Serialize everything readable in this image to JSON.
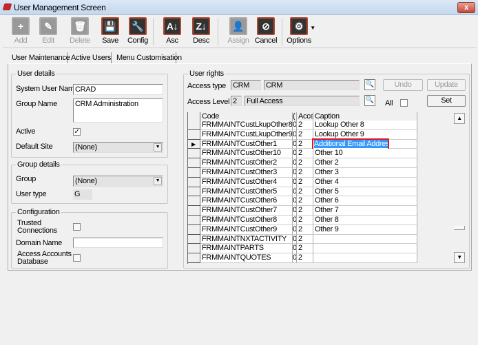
{
  "window": {
    "title": "User Management Screen",
    "close_label": "x"
  },
  "toolbar": [
    {
      "label": "Add",
      "icon": "plus-icon",
      "glyph": "+",
      "enabled": false
    },
    {
      "label": "Edit",
      "icon": "edit-icon",
      "glyph": "✎",
      "enabled": false
    },
    {
      "label": "Delete",
      "icon": "trash-icon",
      "glyph": "🗑",
      "enabled": false
    },
    {
      "label": "Save",
      "icon": "floppy-icon",
      "glyph": "💾",
      "enabled": true
    },
    {
      "label": "Config",
      "icon": "wrench-icon",
      "glyph": "🔧",
      "enabled": true
    },
    {
      "label": "Asc",
      "icon": "sort-asc-icon",
      "glyph": "A↓",
      "enabled": true
    },
    {
      "label": "Desc",
      "icon": "sort-desc-icon",
      "glyph": "Z↓",
      "enabled": true
    },
    {
      "label": "Assign",
      "icon": "user-icon",
      "glyph": "👤",
      "enabled": false
    },
    {
      "label": "Cancel",
      "icon": "cancel-icon",
      "glyph": "⊘",
      "enabled": true
    },
    {
      "label": "Options",
      "icon": "gear-icon",
      "glyph": "⚙",
      "enabled": true
    }
  ],
  "tabs": [
    "User Maintenance",
    "Active Users",
    "Menu Customisation"
  ],
  "user_details": {
    "legend": "User details",
    "system_user_name_label": "System User Name",
    "system_user_name": "CRAD",
    "group_name_label": "Group Name",
    "group_name": "CRM Administration",
    "active_label": "Active",
    "active_check": "✓",
    "default_site_label": "Default Site",
    "default_site": "(None)"
  },
  "group_details": {
    "legend": "Group details",
    "group_label": "Group",
    "group": "(None)",
    "user_type_label": "User type",
    "user_type": "G"
  },
  "configuration": {
    "legend": "Configuration",
    "trusted_label_1": "Trusted",
    "trusted_label_2": "Connections",
    "domain_label": "Domain Name",
    "domain": "",
    "access_label_1": "Access Accounts",
    "access_label_2": "Database"
  },
  "user_rights": {
    "legend": "User rights",
    "access_type_label": "Access type",
    "access_type_code": "CRM",
    "access_type_name": "CRM",
    "access_level_label": "Access Level",
    "access_level_code": "2",
    "access_level_name": "Full Access",
    "all_label": "All",
    "undo": "Undo",
    "update": "Update",
    "set": "Set"
  },
  "grid": {
    "headers": [
      "Code",
      "(",
      "Acce",
      "Caption"
    ],
    "rows": [
      [
        "FRMMAINTCustLkupOther8",
        "0",
        "2",
        "Lookup Other 8"
      ],
      [
        "FRMMAINTCustLkupOther9",
        "0",
        "2",
        "Lookup Other 9"
      ],
      [
        "FRMMAINTCustOther1",
        "0",
        "2",
        "Additional Email Address"
      ],
      [
        "FRMMAINTCustOther10",
        "0",
        "2",
        "Other 10"
      ],
      [
        "FRMMAINTCustOther2",
        "0",
        "2",
        "Other 2"
      ],
      [
        "FRMMAINTCustOther3",
        "0",
        "2",
        "Other 3"
      ],
      [
        "FRMMAINTCustOther4",
        "0",
        "2",
        "Other 4"
      ],
      [
        "FRMMAINTCustOther5",
        "0",
        "2",
        "Other 5"
      ],
      [
        "FRMMAINTCustOther6",
        "0",
        "2",
        "Other 6"
      ],
      [
        "FRMMAINTCustOther7",
        "0",
        "2",
        "Other 7"
      ],
      [
        "FRMMAINTCustOther8",
        "0",
        "2",
        "Other 8"
      ],
      [
        "FRMMAINTCustOther9",
        "0",
        "2",
        "Other 9"
      ],
      [
        "FRMMAINTNXTACTIVITY",
        "0",
        "2",
        ""
      ],
      [
        "FRMMAINTPARTS",
        "0",
        "2",
        ""
      ],
      [
        "FRMMAINTQUOTES",
        "0",
        "2",
        ""
      ]
    ],
    "current_row": 2,
    "highlight_color": "#e0141e",
    "selection_color": "#3399ff"
  }
}
